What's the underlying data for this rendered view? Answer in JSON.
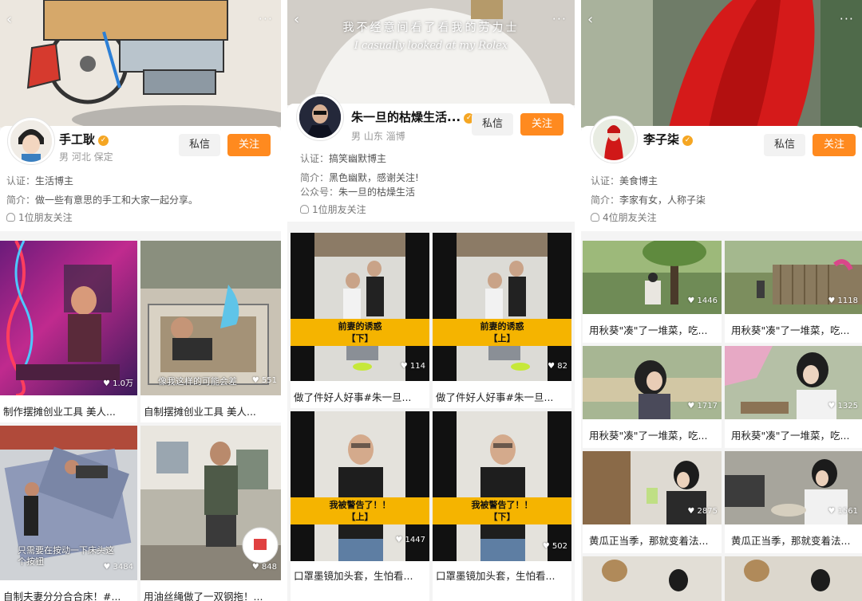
{
  "panels": [
    {
      "nav": {
        "back": "‹",
        "more": "···"
      },
      "user": {
        "name": "手工耿",
        "meta": "男 河北 保定"
      },
      "buttons": {
        "message": "私信",
        "follow": "关注"
      },
      "info": {
        "cert_label": "认证：",
        "cert_value": "生活博主",
        "intro_label": "简介：",
        "intro_value": "做一些有意思的手工和大家一起分享。"
      },
      "friends": "1位朋友关注",
      "cards": [
        {
          "likes": "1.0万",
          "caption": "制作摆摊创业工具  美人..."
        },
        {
          "likes": "551",
          "caption": "自制摆摊创业工具  美人...",
          "overlay": "像我这样的可能会差"
        },
        {
          "likes": "3484",
          "caption": "自制夫妻分分合合床！#...",
          "overlay": "只需要在按动一下床头这个按钮"
        },
        {
          "likes": "848",
          "caption": "用油丝绳做了一双钢拖！..."
        }
      ],
      "colors": {
        "banner": "#d8d3cc"
      }
    },
    {
      "nav": {
        "back": "‹",
        "more": "···"
      },
      "banner_text": {
        "cn": "我不经意间看了看我的劳力士",
        "en": "I casually looked at my Rolex"
      },
      "user": {
        "name": "朱一旦的枯燥生活...",
        "meta": "男 山东 淄博"
      },
      "buttons": {
        "message": "私信",
        "follow": "关注"
      },
      "info": {
        "cert_label": "认证：",
        "cert_value": "搞笑幽默博主",
        "intro_label": "简介：",
        "intro_value": "黑色幽默，感谢关注!",
        "pub_label": "公众号：",
        "pub_value": "朱一旦的枯燥生活"
      },
      "friends": "1位朋友关注",
      "cards": [
        {
          "likes": "114",
          "caption": "做了件好人好事#朱一旦...",
          "tag1": "前妻的诱惑",
          "tag2": "【下】"
        },
        {
          "likes": "82",
          "caption": "做了件好人好事#朱一旦...",
          "tag1": "前妻的诱惑",
          "tag2": "【上】"
        },
        {
          "likes": "1447",
          "caption": "口罩墨镜加头套，生怕看...",
          "tag1": "我被警告了！！",
          "tag2": "【上】"
        },
        {
          "likes": "502",
          "caption": "口罩墨镜加头套，生怕看...",
          "tag1": "我被警告了！！",
          "tag2": "【下】"
        }
      ]
    },
    {
      "nav": {
        "back": "‹",
        "more": "···"
      },
      "user": {
        "name": "李子柒",
        "meta": ""
      },
      "buttons": {
        "message": "私信",
        "follow": "关注"
      },
      "info": {
        "cert_label": "认证：",
        "cert_value": "美食博主",
        "intro_label": "简介：",
        "intro_value": "李家有女，人称子柒"
      },
      "friends": "4位朋友关注",
      "cards": [
        {
          "likes": "1446",
          "caption": "用秋葵\"凑\"了一堆菜，吃..."
        },
        {
          "likes": "1118",
          "caption": "用秋葵\"凑\"了一堆菜，吃..."
        },
        {
          "likes": "1717",
          "caption": "用秋葵\"凑\"了一堆菜，吃..."
        },
        {
          "likes": "1325",
          "caption": "用秋葵\"凑\"了一堆菜，吃..."
        },
        {
          "likes": "2875",
          "caption": "黄瓜正当季，那就变着法..."
        },
        {
          "likes": "1561",
          "caption": "黄瓜正当季，那就变着法..."
        }
      ]
    }
  ],
  "colors": {
    "accent": "#ff8a1f",
    "verified": "#f5a623",
    "tag": "#f5b400"
  }
}
